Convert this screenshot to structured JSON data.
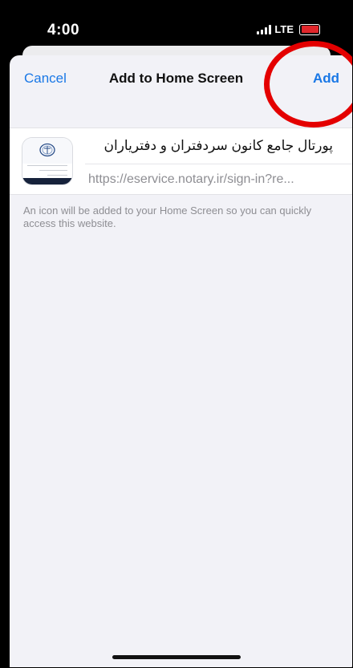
{
  "status_bar": {
    "time": "4:00",
    "network": "LTE"
  },
  "nav": {
    "cancel_label": "Cancel",
    "title": "Add to Home Screen",
    "add_label": "Add"
  },
  "card": {
    "app_title": "پورتال جامع کانون سردفتران و دفترياران",
    "url": "https://eservice.notary.ir/sign-in?re..."
  },
  "note": "An icon will be added to your Home Screen so you can quickly access this website.",
  "colors": {
    "accent": "#1a78e6",
    "background": "#f2f2f7",
    "annotation": "#e40000"
  }
}
